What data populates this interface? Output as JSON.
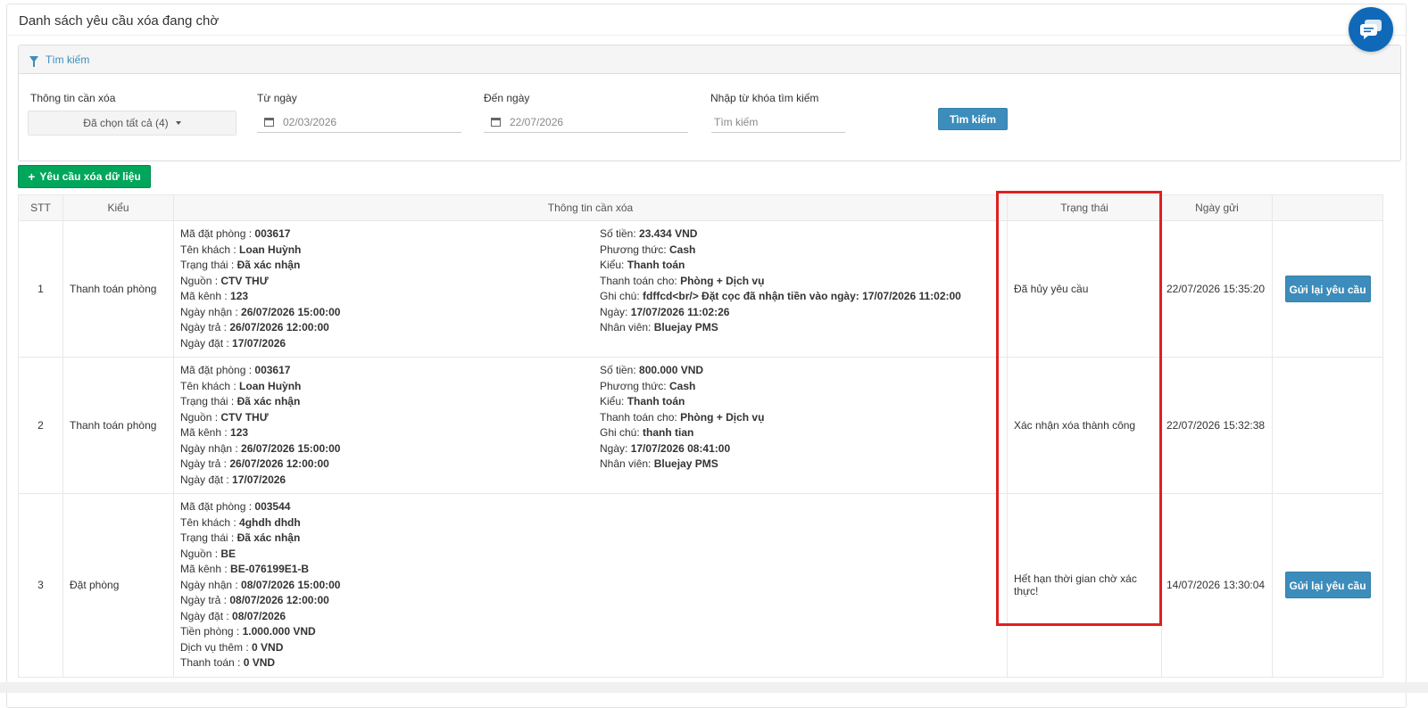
{
  "page": {
    "title": "Danh sách yêu cầu xóa đang chờ"
  },
  "search": {
    "header": "Tìm kiếm",
    "info_label": "Thông tin cần xóa",
    "info_value": "Đã chọn tất cả (4)",
    "from_label": "Từ ngày",
    "from_value": "02/03/2026",
    "to_label": "Đến ngày",
    "to_value": "22/07/2026",
    "keyword_label": "Nhập từ khóa tìm kiếm",
    "keyword_placeholder": "Tìm kiếm",
    "button": "Tìm kiếm"
  },
  "add_button": "Yêu cầu xóa dữ liệu",
  "table": {
    "headers": [
      "STT",
      "Kiểu",
      "Thông tin cần xóa",
      "Trạng thái",
      "Ngày gửi",
      ""
    ],
    "rows": [
      {
        "stt": "1",
        "kind": "Thanh toán phòng",
        "info_left": [
          {
            "k": "Mã đặt phòng : ",
            "v": "003617"
          },
          {
            "k": "Tên khách : ",
            "v": "Loan Huỳnh"
          },
          {
            "k": "Trạng thái : ",
            "v": "Đã xác nhận"
          },
          {
            "k": "Nguồn : ",
            "v": "CTV THƯ"
          },
          {
            "k": "Mã kênh : ",
            "v": "123"
          },
          {
            "k": "Ngày nhận : ",
            "v": "26/07/2026 15:00:00"
          },
          {
            "k": "Ngày trả : ",
            "v": "26/07/2026 12:00:00"
          },
          {
            "k": "Ngày đặt : ",
            "v": "17/07/2026"
          }
        ],
        "info_right": [
          {
            "k": "Số tiền: ",
            "v": "23.434 VND"
          },
          {
            "k": "Phương thức: ",
            "v": "Cash"
          },
          {
            "k": "Kiểu: ",
            "v": "Thanh toán"
          },
          {
            "k": "Thanh toán cho: ",
            "v": "Phòng + Dịch vụ"
          },
          {
            "k": "Ghi chú: ",
            "v": "fdffcd<br/> Đặt cọc đã nhận tiền vào ngày: 17/07/2026 11:02:00"
          },
          {
            "k": "Ngày: ",
            "v": "17/07/2026 11:02:26"
          },
          {
            "k": "Nhân viên: ",
            "v": "Bluejay PMS"
          }
        ],
        "status": "Đã hủy yêu cầu",
        "date": "22/07/2026 15:35:20",
        "action": "Gửi lại yêu cầu"
      },
      {
        "stt": "2",
        "kind": "Thanh toán phòng",
        "info_left": [
          {
            "k": "Mã đặt phòng : ",
            "v": "003617"
          },
          {
            "k": "Tên khách : ",
            "v": "Loan Huỳnh"
          },
          {
            "k": "Trạng thái : ",
            "v": "Đã xác nhận"
          },
          {
            "k": "Nguồn : ",
            "v": "CTV THƯ"
          },
          {
            "k": "Mã kênh : ",
            "v": "123"
          },
          {
            "k": "Ngày nhận : ",
            "v": "26/07/2026 15:00:00"
          },
          {
            "k": "Ngày trả : ",
            "v": "26/07/2026 12:00:00"
          },
          {
            "k": "Ngày đặt : ",
            "v": "17/07/2026"
          }
        ],
        "info_right": [
          {
            "k": "Số tiền: ",
            "v": "800.000 VND"
          },
          {
            "k": "Phương thức: ",
            "v": "Cash"
          },
          {
            "k": "Kiểu: ",
            "v": "Thanh toán"
          },
          {
            "k": "Thanh toán cho: ",
            "v": "Phòng + Dịch vụ"
          },
          {
            "k": "Ghi chú: ",
            "v": "thanh tian"
          },
          {
            "k": "Ngày: ",
            "v": "17/07/2026 08:41:00"
          },
          {
            "k": "Nhân viên: ",
            "v": "Bluejay PMS"
          }
        ],
        "status": "Xác nhận xóa thành công",
        "date": "22/07/2026 15:32:38",
        "action": ""
      },
      {
        "stt": "3",
        "kind": "Đặt phòng",
        "info_left": [
          {
            "k": "Mã đặt phòng : ",
            "v": "003544"
          },
          {
            "k": "Tên khách : ",
            "v": "4ghdh dhdh"
          },
          {
            "k": "Trạng thái : ",
            "v": "Đã xác nhận"
          },
          {
            "k": "Nguồn : ",
            "v": "BE"
          },
          {
            "k": "Mã kênh : ",
            "v": "BE-076199E1-B"
          },
          {
            "k": "Ngày nhận : ",
            "v": "08/07/2026 15:00:00"
          },
          {
            "k": "Ngày trả : ",
            "v": "08/07/2026 12:00:00"
          },
          {
            "k": "Ngày đặt : ",
            "v": "08/07/2026"
          },
          {
            "k": "Tiền phòng : ",
            "v": "1.000.000 VND"
          },
          {
            "k": "Dịch vụ thêm : ",
            "v": "0 VND"
          },
          {
            "k": "Thanh toán : ",
            "v": "0 VND"
          }
        ],
        "info_right": [],
        "status": "Hết hạn thời gian chờ xác thực!",
        "date": "14/07/2026 13:30:04",
        "action": "Gửi lại yêu cầu"
      }
    ]
  },
  "colors": {
    "primary": "#3c8dbc",
    "success": "#00a65a",
    "highlight": "#e02020",
    "chat": "#0f69b8"
  }
}
